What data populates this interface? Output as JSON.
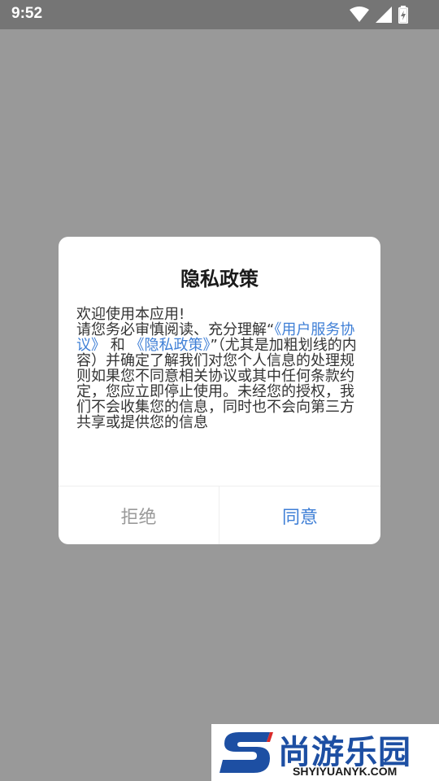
{
  "status_bar": {
    "time": "9:52",
    "icons": [
      "wifi-icon",
      "signal-icon",
      "battery-charging-icon"
    ]
  },
  "dialog": {
    "title": "隐私政策",
    "body": {
      "line1": "欢迎使用本应用!",
      "intro": "请您务必审慎阅读、充分理解“",
      "link_terms": "《用户服务协议》",
      "and": "和",
      "link_privacy": "《隐私政策》",
      "rest": "”（尤其是加粗划线的内容）并确定了解我们对您个人信息的处理规则如果您不同意相关协议或其中任何条款约定，您应立即停止使用。未经您的授权，我们不会收集您的信息，同时也不会向第三方共享或提供您的信息"
    },
    "reject_label": "拒绝",
    "agree_label": "同意"
  },
  "watermark": {
    "brand": "尚游乐园",
    "url": "SHYIYUANYK.COM"
  },
  "colors": {
    "overlay": "#999999",
    "status_bar": "#757575",
    "link": "#3f7fd6",
    "reject": "#9a9a9a",
    "brand_blue": "#1d4fa3"
  }
}
